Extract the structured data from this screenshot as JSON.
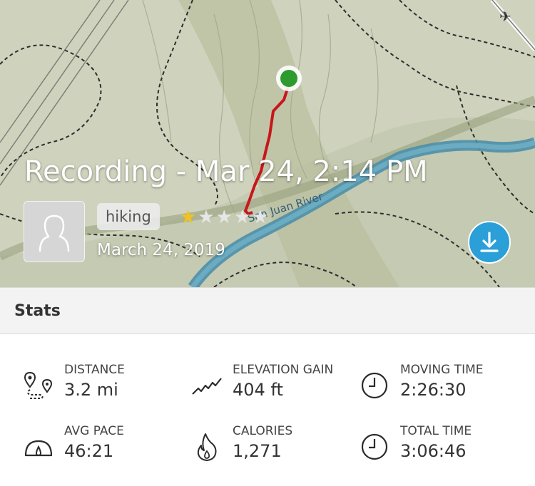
{
  "activity": {
    "title": "Recording - Mar 24, 2:14 PM",
    "tag": "hiking",
    "rating": 1,
    "rating_max": 5,
    "date": "March 24, 2019"
  },
  "map": {
    "river_label": "San Juan River"
  },
  "stats": {
    "header": "Stats",
    "items": [
      {
        "icon": "route-icon",
        "label": "DISTANCE",
        "value": "3.2 mi"
      },
      {
        "icon": "elevation-icon",
        "label": "ELEVATION GAIN",
        "value": "404 ft"
      },
      {
        "icon": "clock-icon",
        "label": "MOVING TIME",
        "value": "2:26:30"
      },
      {
        "icon": "speedometer-icon",
        "label": "AVG PACE",
        "value": "46:21"
      },
      {
        "icon": "flame-icon",
        "label": "CALORIES",
        "value": "1,271"
      },
      {
        "icon": "clock-icon",
        "label": "TOTAL TIME",
        "value": "3:06:46"
      }
    ]
  },
  "colors": {
    "track": "#c8161b",
    "river": "#4d8fa8",
    "download_button": "#2a9fd8",
    "star_filled": "#f2c31c"
  }
}
